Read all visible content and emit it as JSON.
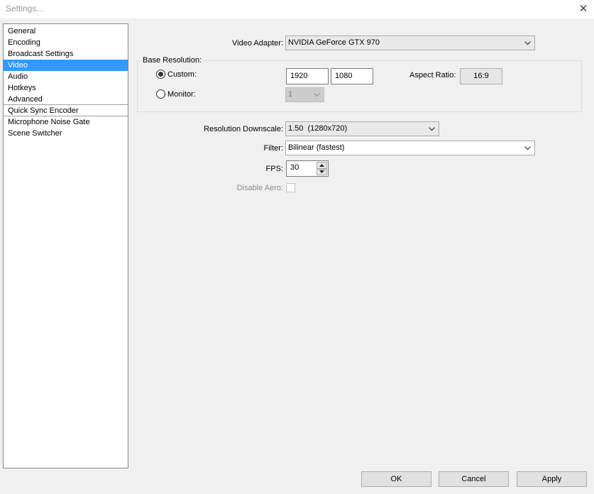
{
  "window": {
    "title": "Settings...",
    "close_glyph": "✕"
  },
  "sidebar": {
    "items": [
      {
        "label": "General"
      },
      {
        "label": "Encoding"
      },
      {
        "label": "Broadcast Settings"
      },
      {
        "label": "Video",
        "selected": true
      },
      {
        "label": "Audio"
      },
      {
        "label": "Hotkeys"
      },
      {
        "label": "Advanced"
      },
      {
        "label": "Quick Sync Encoder"
      },
      {
        "label": "Microphone Noise Gate"
      },
      {
        "label": "Scene Switcher"
      }
    ]
  },
  "video": {
    "adapter_label": "Video Adapter:",
    "adapter_value": "NVIDIA GeForce GTX 970",
    "base_resolution_label": "Base Resolution:",
    "custom_label": "Custom:",
    "custom_selected": true,
    "width_value": "1920",
    "height_value": "1080",
    "aspect_label": "Aspect Ratio:",
    "aspect_value": "16:9",
    "monitor_label": "Monitor:",
    "monitor_value": "1",
    "downscale_label": "Resolution Downscale:",
    "downscale_value": "1.50  (1280x720)",
    "filter_label": "Filter:",
    "filter_value": "Bilinear (fastest)",
    "fps_label": "FPS:",
    "fps_value": "30",
    "disable_aero_label": "Disable Aero:",
    "disable_aero_checked": false
  },
  "buttons": {
    "ok": "OK",
    "cancel": "Cancel",
    "apply": "Apply"
  },
  "colors": {
    "selection": "#3399ff",
    "window_bg": "#f0f0f0"
  }
}
